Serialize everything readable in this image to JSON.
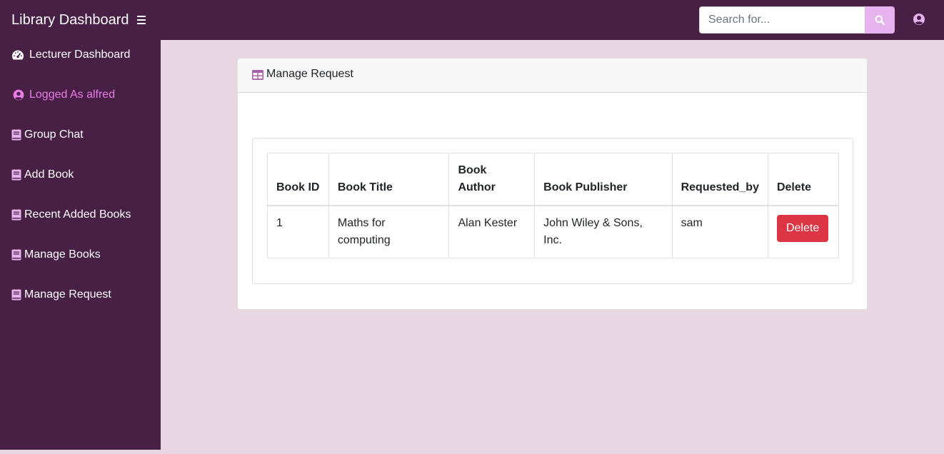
{
  "app": {
    "title": "Library Dashboard"
  },
  "header": {
    "search_placeholder": "Search for...",
    "colors": {
      "bar": "#481f45",
      "search_button": "#e7b3ef"
    }
  },
  "sidebar": {
    "items": [
      {
        "label": "Lecturer Dashboard",
        "icon": "tachometer-icon"
      },
      {
        "label": "Logged As alfred",
        "icon": "user-circle-icon",
        "active": true
      },
      {
        "label": "Group Chat",
        "icon": "book-icon"
      },
      {
        "label": "Add Book",
        "icon": "book-icon"
      },
      {
        "label": "Recent Added Books",
        "icon": "book-icon"
      },
      {
        "label": "Manage Books",
        "icon": "book-icon"
      },
      {
        "label": "Manage Request",
        "icon": "book-icon"
      }
    ],
    "active_color": "#e87de8"
  },
  "main": {
    "card_title": "Manage Request",
    "table": {
      "headers": [
        "Book ID",
        "Book Title",
        "Book Author",
        "Book Publisher",
        "Requested_by",
        "Delete"
      ],
      "rows": [
        {
          "book_id": "1",
          "title": "Maths for computing",
          "author": "Alan Kester",
          "publisher": "John Wiley & Sons, Inc.",
          "requested_by": "sam",
          "action": "Delete"
        }
      ]
    },
    "delete_color": "#dc3545"
  }
}
